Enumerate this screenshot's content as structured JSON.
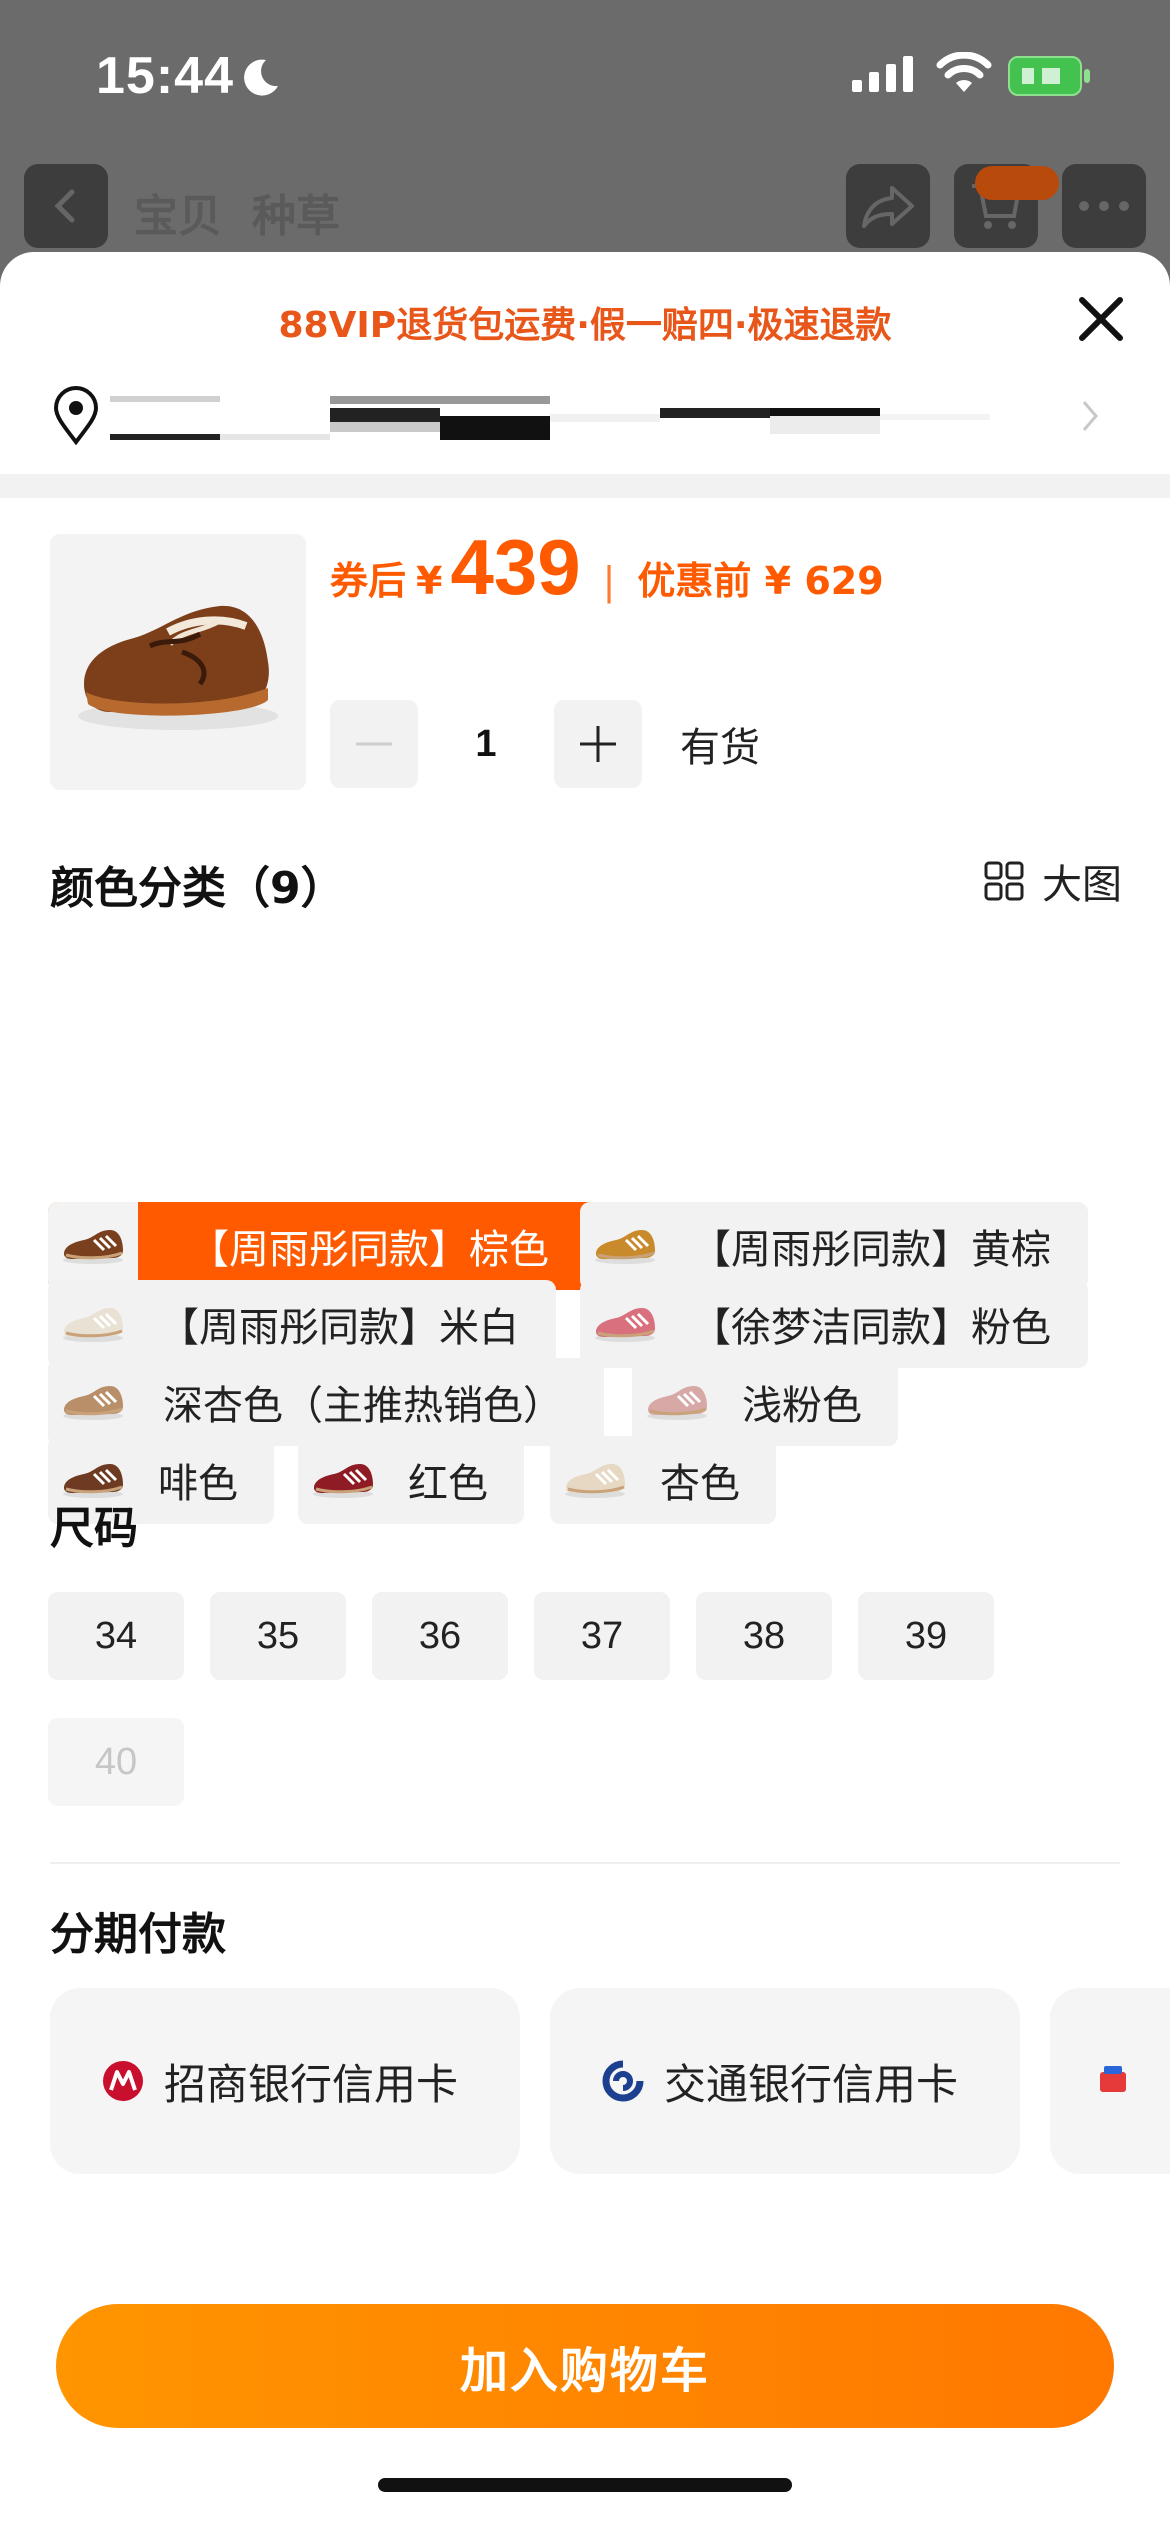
{
  "status_bar": {
    "time": "15:44"
  },
  "nav": {
    "tabs": [
      "宝贝",
      "种草"
    ]
  },
  "sheet": {
    "promo": "88VIP退货包运费·假一赔四·极速退款",
    "price": {
      "label": "券后",
      "currency": "¥",
      "value": "439",
      "separator": "|",
      "before_label": "优惠前 ¥ 629"
    },
    "quantity": {
      "value": "1",
      "stock": "有货"
    },
    "color_section": {
      "title": "颜色分类（9）",
      "big_pic_label": "大图",
      "options": [
        {
          "label": "【周雨彤同款】棕色",
          "selected": true,
          "swatch": "#7a3f1c"
        },
        {
          "label": "【周雨彤同款】黄棕",
          "selected": false,
          "swatch": "#c98a2c"
        },
        {
          "label": "【周雨彤同款】米白",
          "selected": false,
          "swatch": "#e9e2d4"
        },
        {
          "label": "【徐梦洁同款】粉色",
          "selected": false,
          "swatch": "#d9707e"
        },
        {
          "label": "深杏色（主推热销色）",
          "selected": false,
          "swatch": "#b98f6a"
        },
        {
          "label": "浅粉色",
          "selected": false,
          "swatch": "#d7a8a6"
        },
        {
          "label": "啡色",
          "selected": false,
          "swatch": "#6e3a22"
        },
        {
          "label": "红色",
          "selected": false,
          "swatch": "#8f1c24"
        },
        {
          "label": "杏色",
          "selected": false,
          "swatch": "#e6d8c2"
        }
      ]
    },
    "size_section": {
      "title": "尺码",
      "sizes": [
        {
          "label": "34",
          "available": true
        },
        {
          "label": "35",
          "available": true
        },
        {
          "label": "36",
          "available": true
        },
        {
          "label": "37",
          "available": true
        },
        {
          "label": "38",
          "available": true
        },
        {
          "label": "39",
          "available": true
        },
        {
          "label": "40",
          "available": false
        }
      ]
    },
    "installment": {
      "title": "分期付款",
      "banks": [
        {
          "label": "招商银行信用卡",
          "icon": "cmb-bank-icon",
          "color": "#c8102e"
        },
        {
          "label": "交通银行信用卡",
          "icon": "bocom-bank-icon",
          "color": "#1d3f8f"
        }
      ]
    },
    "cta": {
      "label": "加入购物车"
    }
  },
  "colors": {
    "accent": "#ff5a00",
    "cta": "#ff8a00",
    "promo": "#e8561a"
  }
}
